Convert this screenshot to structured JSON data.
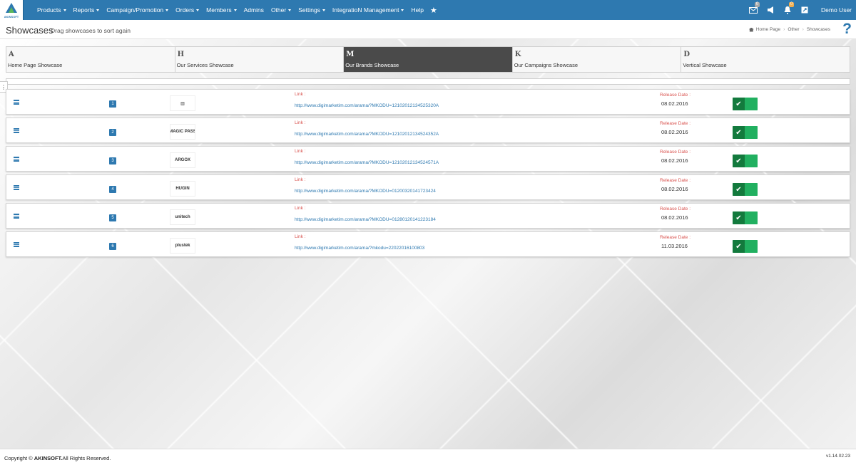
{
  "topbar": {
    "logo_text": "AKINSOFT",
    "nav": [
      {
        "label": "Products",
        "dropdown": true
      },
      {
        "label": "Reports",
        "dropdown": true
      },
      {
        "label": "Campaign/Promotion",
        "dropdown": true
      },
      {
        "label": "Orders",
        "dropdown": true
      },
      {
        "label": "Members",
        "dropdown": true
      },
      {
        "label": "Admins",
        "dropdown": false
      },
      {
        "label": "Other",
        "dropdown": true
      },
      {
        "label": "Settings",
        "dropdown": true
      },
      {
        "label": "IntegratioN Management",
        "dropdown": true
      },
      {
        "label": "Help",
        "dropdown": false
      }
    ],
    "notifications_badge": "0",
    "messages_badge": "0",
    "user_name": "Demo User"
  },
  "titlebar": {
    "title": "Showcases",
    "subtitle": "Drag showcases to sort again",
    "breadcrumb": [
      "Home Page",
      "Other",
      "Showcases"
    ],
    "help": "?"
  },
  "tabs": [
    {
      "letter": "A",
      "name": "Home Page Showcase",
      "active": false
    },
    {
      "letter": "H",
      "name": "Our Services Showcase",
      "active": false
    },
    {
      "letter": "M",
      "name": "Our Brands Showcase",
      "active": true
    },
    {
      "letter": "K",
      "name": "Our Campaigns Showcase",
      "active": false
    },
    {
      "letter": "D",
      "name": "Vertical Showcase",
      "active": false
    }
  ],
  "rows": [
    {
      "num": "1",
      "brand": "▥",
      "link_label": "Link :",
      "url": "http://www.digimarketim.com/arama/?MKODU=12102012134525320A",
      "date_label": "Release Date :",
      "date": "08.02.2016"
    },
    {
      "num": "2",
      "brand": "MAGIC PASS",
      "link_label": "Link :",
      "url": "http://www.digimarketim.com/arama/?MKODU=12102012134524352A",
      "date_label": "Release Date :",
      "date": "08.02.2016"
    },
    {
      "num": "3",
      "brand": "ARGOX",
      "link_label": "Link :",
      "url": "http://www.digimarketim.com/arama/?MKODU=12102012134524571A",
      "date_label": "Release Date :",
      "date": "08.02.2016"
    },
    {
      "num": "4",
      "brand": "HUGIN",
      "link_label": "Link :",
      "url": "http://www.digimarketim.com/arama/?MKODU=01200320141723424",
      "date_label": "Release Date :",
      "date": "08.02.2016"
    },
    {
      "num": "5",
      "brand": "unitech",
      "link_label": "Link :",
      "url": "http://www.digimarketim.com/arama/?MKODU=01280120141223184",
      "date_label": "Release Date :",
      "date": "08.02.2016"
    },
    {
      "num": "6",
      "brand": "plustek",
      "link_label": "Link :",
      "url": "http://www.digimarketim.com/arama/?mkodu=22022016100803",
      "date_label": "Release Date :",
      "date": "11.03.2016"
    }
  ],
  "footer": {
    "copyright_prefix": "Copyright © ",
    "company": "AKINSOFT.",
    "copyright_suffix": "All Rights Reserved.",
    "version": "v1.14.02.23"
  },
  "colors": {
    "topbar": "#2e79b0",
    "active_tab": "#4a4a4a",
    "toggle_on": "#21b060",
    "link_label": "#d9534f"
  }
}
